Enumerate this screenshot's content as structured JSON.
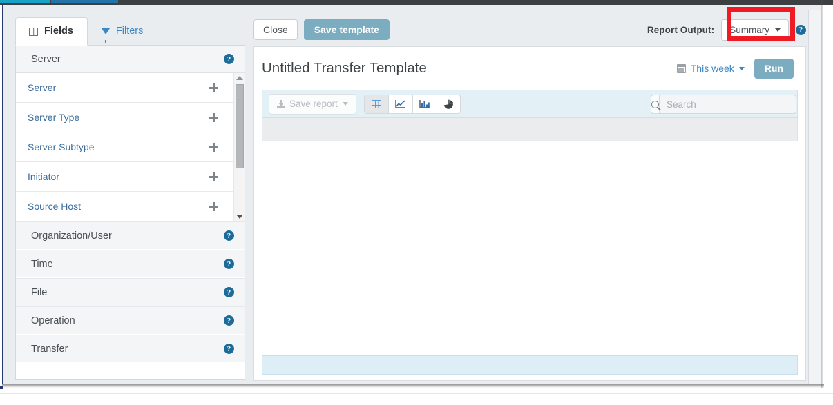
{
  "window": {
    "left_tabs": [
      {
        "label": "Fields",
        "icon": "columns-icon",
        "active": true
      },
      {
        "label": "Filters",
        "icon": "funnel-icon",
        "active": false
      }
    ]
  },
  "fields_panel": {
    "expanded_section": {
      "title": "Server",
      "help_icon": "help-circle-icon",
      "items": [
        {
          "label": "Server",
          "add_icon": "plus-icon"
        },
        {
          "label": "Server Type",
          "add_icon": "plus-icon"
        },
        {
          "label": "Server Subtype",
          "add_icon": "plus-icon"
        },
        {
          "label": "Initiator",
          "add_icon": "plus-icon"
        },
        {
          "label": "Source Host",
          "add_icon": "plus-icon"
        }
      ],
      "scrollbar": {
        "up_icon": "caret-up-icon",
        "down_icon": "caret-down-icon"
      }
    },
    "collapsed_sections": [
      {
        "title": "Organization/User",
        "help_icon": "help-circle-icon"
      },
      {
        "title": "Time",
        "help_icon": "help-circle-icon"
      },
      {
        "title": "File",
        "help_icon": "help-circle-icon"
      },
      {
        "title": "Operation",
        "help_icon": "help-circle-icon"
      },
      {
        "title": "Transfer",
        "help_icon": "help-circle-icon"
      }
    ]
  },
  "top_actions": {
    "close_label": "Close",
    "save_template_label": "Save template"
  },
  "report_output": {
    "label": "Report Output:",
    "selected_value": "Summary",
    "caret_icon": "caret-down-icon",
    "help_icon": "help-circle-icon",
    "highlight_color": "#ee1b24"
  },
  "report": {
    "title": "Untitled Transfer Template",
    "date_range": {
      "label": "This week",
      "calendar_icon": "calendar-icon",
      "caret_icon": "caret-down-icon"
    },
    "run_label": "Run",
    "toolbar": {
      "save_report_label": "Save report",
      "save_report_icon": "download-icon",
      "save_report_caret": "caret-down-icon",
      "views": [
        {
          "name": "table",
          "icon": "table-icon",
          "active": true
        },
        {
          "name": "line",
          "icon": "line-chart-icon",
          "active": false
        },
        {
          "name": "bar",
          "icon": "bar-chart-icon",
          "active": false
        },
        {
          "name": "pie",
          "icon": "pie-chart-icon",
          "active": false
        }
      ],
      "search": {
        "placeholder": "Search",
        "value": "",
        "icon": "search-icon"
      }
    }
  },
  "theme": {
    "primary_button": "#7bacc0",
    "link_blue": "#3a87c8",
    "toolbar_blue": "#e3f0f6",
    "help_blue": "#1c6b99"
  }
}
